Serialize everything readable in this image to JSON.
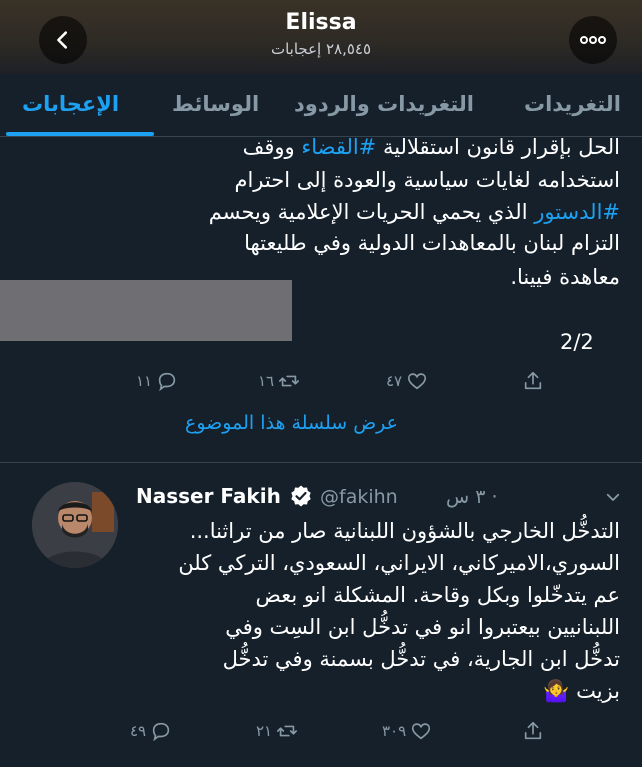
{
  "header": {
    "name": "Elissa",
    "likes_count": "٢٨,٥٤٥ إعجابات",
    "back_icon": "chevron-left-icon",
    "more_icon": "more-horizontal-icon"
  },
  "tabs": [
    {
      "label": "التغريدات"
    },
    {
      "label": "التغريدات والردود"
    },
    {
      "label": "الوسائط"
    },
    {
      "label": "الإعجابات",
      "active": true
    }
  ],
  "tweet1": {
    "lines": [
      {
        "parts": [
          {
            "t": "الحل بإقرار قانون استقلالية "
          },
          {
            "t": "#القضاء",
            "tag": true
          },
          {
            "t": " ووقف"
          }
        ]
      },
      {
        "parts": [
          {
            "t": "استخدامه لغايات سياسية والعودة إلى احترام"
          }
        ]
      },
      {
        "parts": [
          {
            "t": "#الدستور",
            "tag": true
          },
          {
            "t": " الذي يحمي الحريات الإعلامية ويحسم"
          }
        ]
      },
      {
        "parts": [
          {
            "t": "التزام لبنان بالمعاهدات الدولية وفي طليعتها"
          }
        ]
      },
      {
        "parts": [
          {
            "t": "معاهدة فيينا."
          }
        ]
      }
    ],
    "counter": "2/2",
    "actions": {
      "replies": "١١",
      "retweets": "١٦",
      "likes": "٤٧"
    },
    "show_thread": "عرض سلسلة هذا الموضوع"
  },
  "tweet2": {
    "name": "Nasser Fakih",
    "handle": "@fakihn",
    "time": "· ٣ س",
    "lines": [
      "التدخُّل الخارجي بالشؤون اللبنانية صار من تراثنا...",
      "السوري،الاميركاني، الايراني، السعودي، التركي كلن",
      "عم يتدخّلوا وبكل وقاحة. المشكلة انو بعض",
      "اللبنانيين بيعتبروا انو في تدخُّل ابن السِت وفي",
      "تدخُّل ابن الجارية، في تدخُّل بسمنة وفي تدخُّل",
      "بزيت 🤷‍♀️"
    ],
    "actions": {
      "replies": "٤٩",
      "retweets": "٢١",
      "likes": "٣٠٩"
    }
  },
  "colors": {
    "background": "#15202b",
    "accent": "#1da1f2",
    "muted": "#8899a6",
    "divider": "#38444d"
  }
}
